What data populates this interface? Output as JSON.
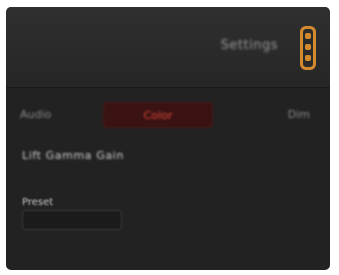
{
  "header": {
    "title": "Settings",
    "icon": "switch-icon",
    "accent_color": "#d38a2e"
  },
  "tabs": [
    {
      "label": "Audio",
      "active": false
    },
    {
      "label": "Color",
      "active": true
    },
    {
      "label": "Dim",
      "active": false
    }
  ],
  "content": {
    "section_label": "Lift Gamma Gain",
    "field_label": "Preset",
    "field_value": ""
  },
  "colors": {
    "panel": "#222222",
    "active_tab_text": "#e04a3a"
  }
}
